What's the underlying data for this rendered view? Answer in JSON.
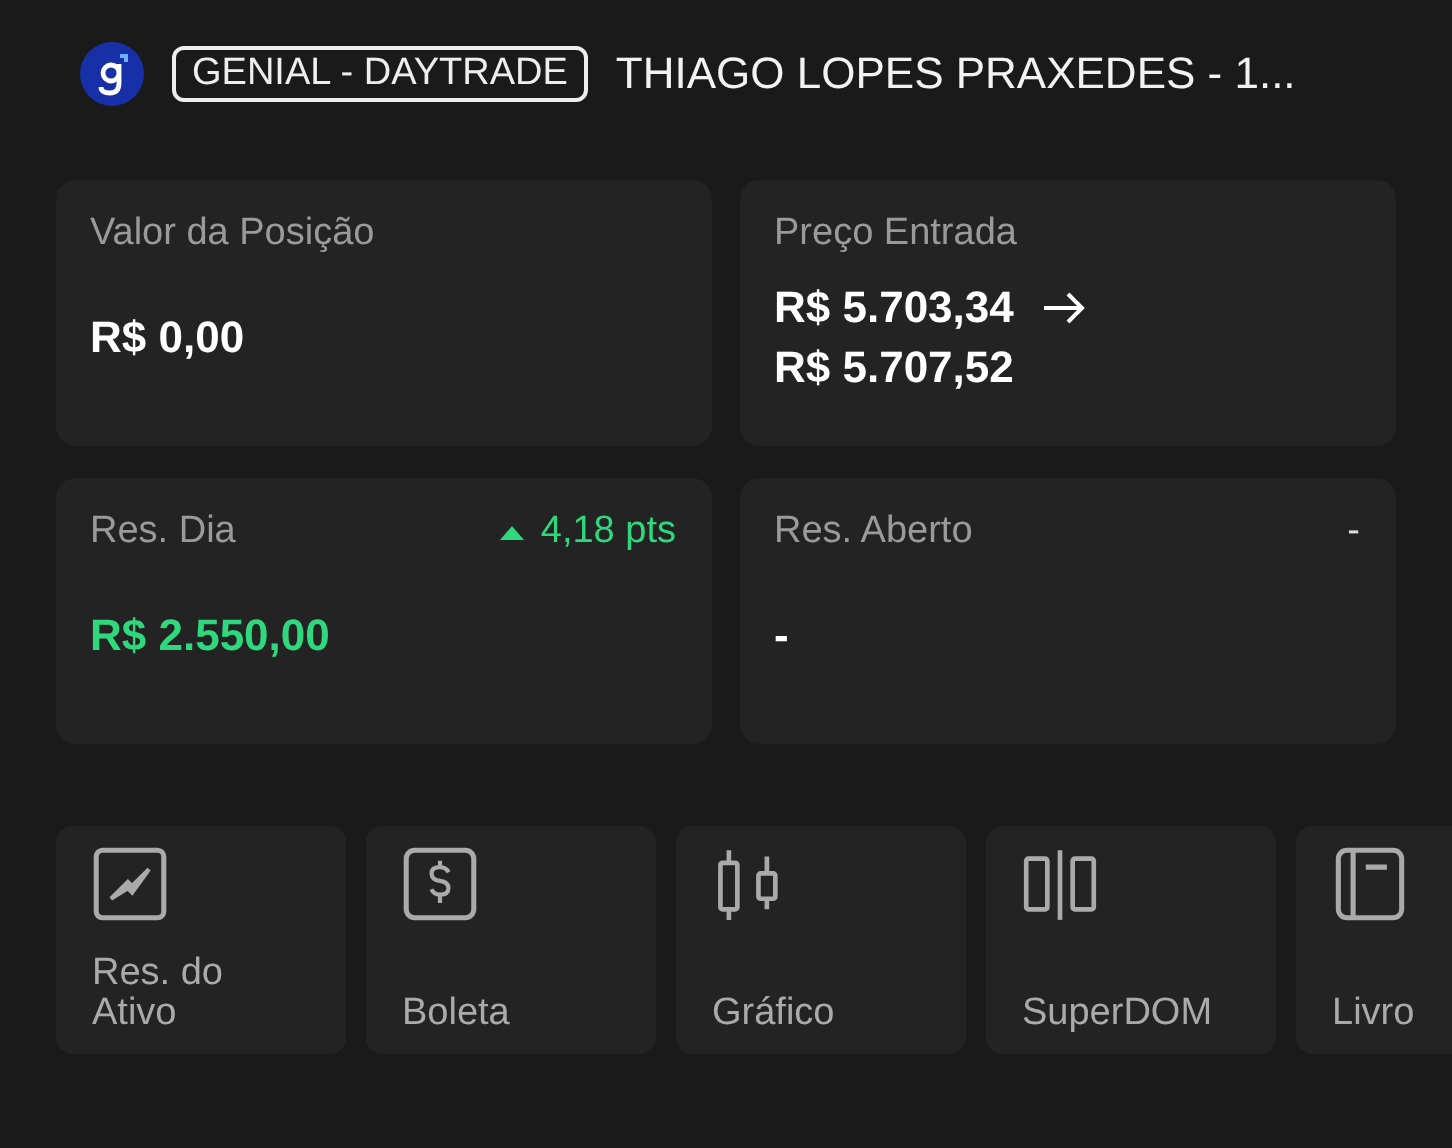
{
  "header": {
    "account_badge": "GENIAL - DAYTRADE",
    "account_name": "THIAGO LOPES PRAXEDES - 1..."
  },
  "cards": [
    {
      "label": "Valor da Posição",
      "kind": "single",
      "positive": false,
      "values": [
        "R$ 0,00"
      ]
    },
    {
      "label": "Preço Entrada",
      "kind": "range",
      "positive": false,
      "values": [
        "R$ 5.703,34",
        "R$ 5.707,52"
      ]
    },
    {
      "label": "Res. Dia",
      "kind": "single",
      "positive": true,
      "change": {
        "text": "4,18 pts",
        "up": true
      },
      "values": [
        "R$ 2.550,00"
      ]
    },
    {
      "label": "Res. Aberto",
      "kind": "single",
      "positive": false,
      "corner": "-",
      "values": [
        "-"
      ]
    }
  ],
  "actions": [
    {
      "label": "Res. do Ativo",
      "kind": "pulse"
    },
    {
      "label": "Boleta",
      "kind": "dollar"
    },
    {
      "label": "Gráfico",
      "kind": "candles"
    },
    {
      "label": "SuperDOM",
      "kind": "columns"
    },
    {
      "label": "Livro",
      "kind": "book"
    }
  ]
}
